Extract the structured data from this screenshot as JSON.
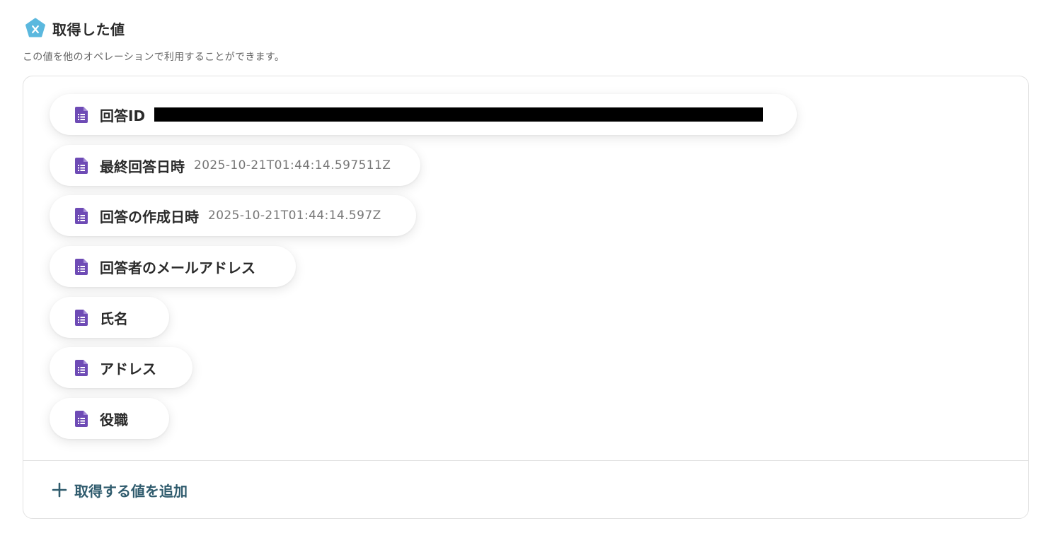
{
  "header": {
    "title": "取得した値",
    "icon": "pentagon-x-icon",
    "icon_color": "#5bb8de"
  },
  "subtitle": "この値を他のオペレーションで利用することができます。",
  "items": [
    {
      "label": "回答ID",
      "value": "",
      "redacted": true,
      "icon": "google-forms-doc-icon"
    },
    {
      "label": "最終回答日時",
      "value": "2025-10-21T01:44:14.597511Z",
      "icon": "google-forms-doc-icon"
    },
    {
      "label": "回答の作成日時",
      "value": "2025-10-21T01:44:14.597Z",
      "icon": "google-forms-doc-icon"
    },
    {
      "label": "回答者のメールアドレス",
      "value": "",
      "icon": "google-forms-doc-icon"
    },
    {
      "label": "氏名",
      "value": "",
      "icon": "google-forms-doc-icon"
    },
    {
      "label": "アドレス",
      "value": "",
      "icon": "google-forms-doc-icon"
    },
    {
      "label": "役職",
      "value": "",
      "icon": "google-forms-doc-icon"
    }
  ],
  "add_button": {
    "label": "取得する値を追加",
    "icon": "plus-icon",
    "color": "#2f5b6d"
  },
  "colors": {
    "doc_icon": "#6e4bb5",
    "text": "#2b2b2b",
    "value_text": "#777777",
    "border": "#e2e2e2"
  }
}
